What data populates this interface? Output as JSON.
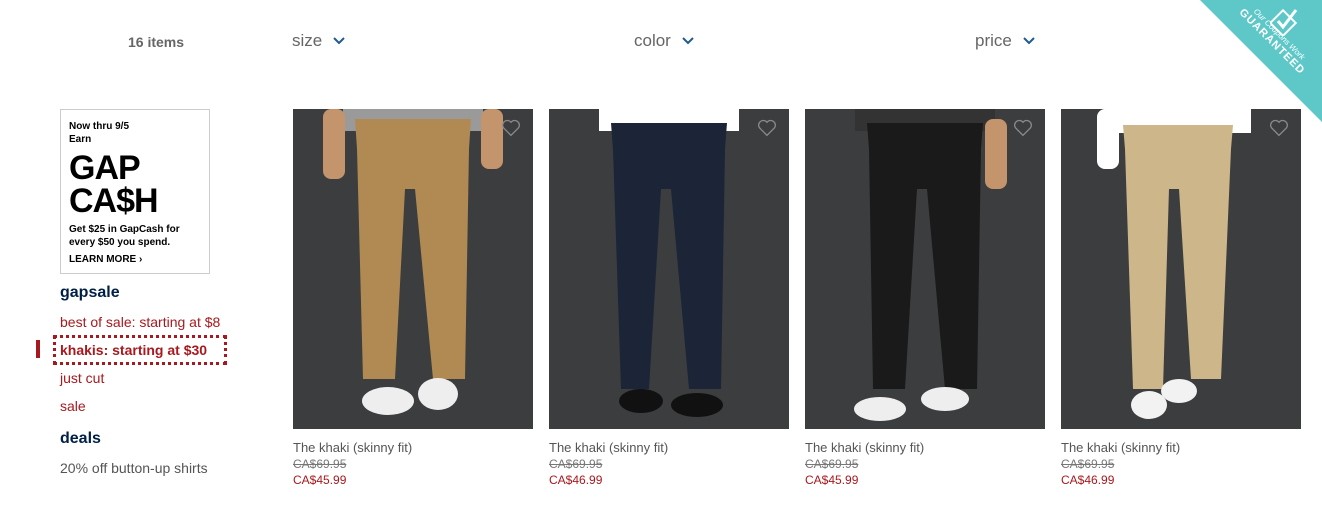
{
  "filters": {
    "items_count": "16 items",
    "size_label": "size",
    "color_label": "color",
    "price_label": "price"
  },
  "ribbon": {
    "small": "Our Coupons Work",
    "big": "GUARANTEED",
    "color": "#5ec8c8"
  },
  "ad": {
    "line1": "Now thru 9/5",
    "line2": "Earn",
    "big1": "GAP",
    "big2": "CA$H",
    "body": "Get $25 in GapCash for every $50 you spend.",
    "more": "LEARN MORE ›"
  },
  "sidebar": {
    "heading1": "gapsale",
    "links": [
      "best of sale: starting at $8",
      "khakis: starting at $30",
      "just cut",
      "sale"
    ],
    "heading2": "deals",
    "deal": "20% off button-up shirts"
  },
  "products": [
    {
      "name": "The khaki (skinny fit)",
      "old_price": "CA$69.95",
      "new_price": "CA$45.99",
      "pant_color": "#b08a52",
      "shirt_color": "#9a9a9a",
      "shoe_color": "#eeeeee"
    },
    {
      "name": "The khaki (skinny fit)",
      "old_price": "CA$69.95",
      "new_price": "CA$46.99",
      "pant_color": "#1c2438",
      "shirt_color": "#ffffff",
      "shoe_color": "#111111"
    },
    {
      "name": "The khaki (skinny fit)",
      "old_price": "CA$69.95",
      "new_price": "CA$45.99",
      "pant_color": "#1a1a1a",
      "shirt_color": "#333333",
      "shoe_color": "#eeeeee"
    },
    {
      "name": "The khaki (skinny fit)",
      "old_price": "CA$69.95",
      "new_price": "CA$46.99",
      "pant_color": "#cdb68a",
      "shirt_color": "#ffffff",
      "shoe_color": "#f2f2f2"
    }
  ],
  "colors": {
    "accent_red": "#a8191f",
    "navy": "#001f47",
    "chevron_blue": "#1f5b8f"
  }
}
